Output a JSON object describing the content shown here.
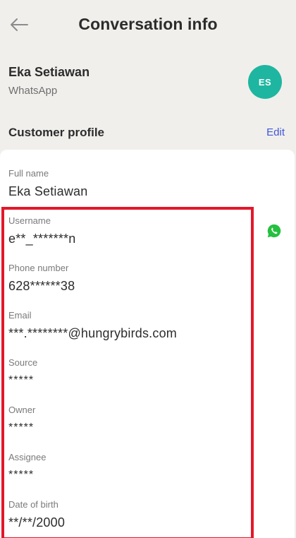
{
  "header": {
    "title": "Conversation info",
    "back_icon": "arrow-left-icon"
  },
  "contact": {
    "name": "Eka Setiawan",
    "channel": "WhatsApp",
    "avatar_initials": "ES",
    "avatar_color": "#1eb6a0"
  },
  "profile": {
    "title": "Customer profile",
    "edit_label": "Edit",
    "accent_color": "#3d57d8",
    "fields": [
      {
        "label": "Full name",
        "value": "Eka Setiawan"
      },
      {
        "label": "Username",
        "value": "e**_*******n"
      },
      {
        "label": "Phone number",
        "value": "628******38"
      },
      {
        "label": "Email",
        "value": "***.********@hungrybirds.com"
      },
      {
        "label": "Source",
        "value": "*****"
      },
      {
        "label": "Owner",
        "value": "*****"
      },
      {
        "label": "Assignee",
        "value": "*****"
      },
      {
        "label": "Date of birth",
        "value": "**/**/2000"
      }
    ]
  },
  "highlight_color": "#e3172a",
  "whatsapp_icon": "whatsapp-icon",
  "whatsapp_color": "#25c03f"
}
